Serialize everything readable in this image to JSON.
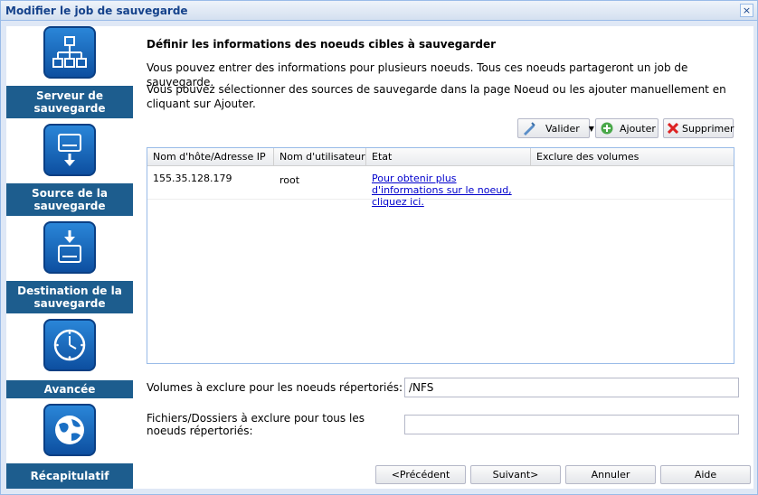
{
  "window": {
    "title": "Modifier le job de sauvegarde",
    "close_glyph": "×"
  },
  "sidebar": {
    "items": [
      {
        "label": "Serveur de sauvegarde",
        "icon": "network-nodes-icon"
      },
      {
        "label": "Source de la sauvegarde",
        "icon": "drive-arrow-out-icon"
      },
      {
        "label": "Destination de la sauvegarde",
        "icon": "drive-arrow-in-icon"
      },
      {
        "label": "Avancée",
        "icon": "clock-icon"
      },
      {
        "label": "Récapitulatif",
        "icon": "globe-icon"
      }
    ],
    "colors": {
      "label_bg": "#1d5d8e",
      "icon_bg": "#1a6fc4"
    }
  },
  "main": {
    "heading": "Définir les informations des noeuds cibles à sauvegarder",
    "para1": "Vous pouvez entrer des informations pour plusieurs noeuds. Tous ces noeuds partageront un job de sauvegarde.",
    "para2": "Vous pouvez sélectionner des sources de sauvegarde dans la page Noeud ou les ajouter manuellement en cliquant sur Ajouter.",
    "toolbar": {
      "validate": "Valider",
      "add": "Ajouter",
      "delete": "Supprimer"
    },
    "table": {
      "columns": [
        "Nom d'hôte/Adresse IP",
        "Nom d'utilisateur",
        "Etat",
        "Exclure des volumes"
      ],
      "rows": [
        {
          "host": "155.35.128.179",
          "user": "root",
          "status": "Pour obtenir plus d'informations sur le noeud, cliquez ici.",
          "exclude": ""
        }
      ]
    },
    "fields": {
      "volumes_label": "Volumes à exclure pour les noeuds répertoriés:",
      "volumes_value": "/NFS",
      "files_label": "Fichiers/Dossiers à exclure pour tous les noeuds répertoriés:",
      "files_value": ""
    },
    "nav": {
      "prev": "<Précédent",
      "next": "Suivant>",
      "cancel": "Annuler",
      "help": "Aide"
    }
  }
}
